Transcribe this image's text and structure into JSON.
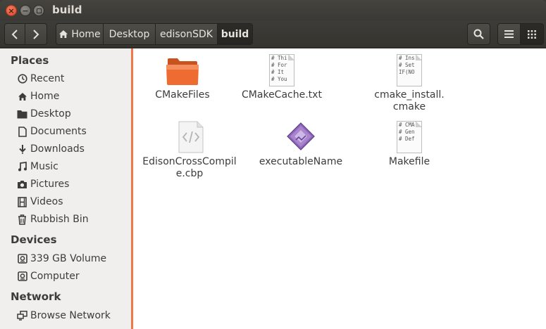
{
  "window": {
    "title": "build"
  },
  "toolbar": {
    "breadcrumbs": [
      "Home",
      "Desktop",
      "edisonSDK",
      "build"
    ]
  },
  "sidebar": {
    "sections": [
      {
        "title": "Places",
        "items": [
          {
            "label": "Recent",
            "icon": "clock-icon"
          },
          {
            "label": "Home",
            "icon": "home-icon"
          },
          {
            "label": "Desktop",
            "icon": "folder-icon"
          },
          {
            "label": "Documents",
            "icon": "document-icon"
          },
          {
            "label": "Downloads",
            "icon": "download-icon"
          },
          {
            "label": "Music",
            "icon": "music-icon"
          },
          {
            "label": "Pictures",
            "icon": "camera-icon"
          },
          {
            "label": "Videos",
            "icon": "film-icon"
          },
          {
            "label": "Rubbish Bin",
            "icon": "trash-icon"
          }
        ]
      },
      {
        "title": "Devices",
        "items": [
          {
            "label": "339 GB Volume",
            "icon": "drive-icon"
          },
          {
            "label": "Computer",
            "icon": "drive-icon"
          }
        ]
      },
      {
        "title": "Network",
        "items": [
          {
            "label": "Browse Network",
            "icon": "network-icon"
          }
        ]
      }
    ]
  },
  "files": [
    {
      "name": "CMakeFiles",
      "type": "folder"
    },
    {
      "name": "CMakeCache.txt",
      "type": "text",
      "preview": [
        "# Thi",
        "# For",
        "# It",
        "# You"
      ]
    },
    {
      "name": "cmake_install.cmake",
      "type": "text",
      "preview": [
        "# Ins",
        "",
        "# Set",
        "IF(NO"
      ]
    },
    {
      "name": "EdisonCrossCompile.cbp",
      "type": "xml"
    },
    {
      "name": "executableName",
      "type": "executable"
    },
    {
      "name": "Makefile",
      "type": "text",
      "preview": [
        "# CMA",
        "# Gen",
        "",
        "# Def"
      ]
    }
  ],
  "colors": {
    "accent": "#f07746",
    "folder": "#e9622c"
  }
}
